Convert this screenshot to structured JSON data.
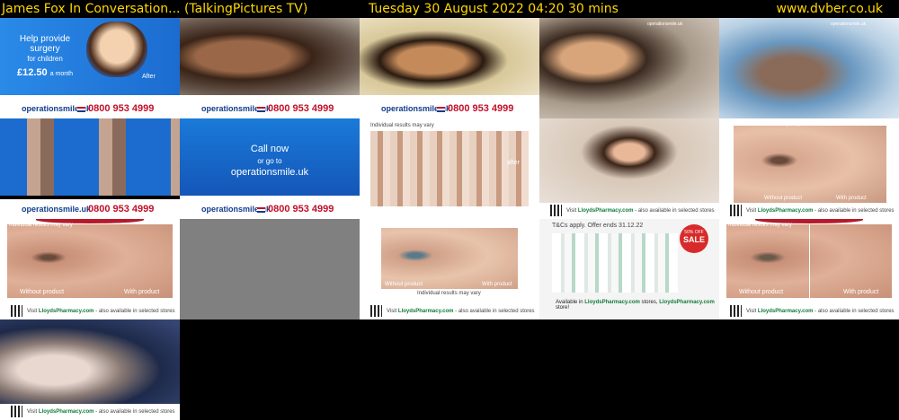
{
  "header": {
    "title": "James Fox In Conversation... (TalkingPictures TV)",
    "datetime": "Tuesday 30 August 2022  04:20  30 mins",
    "site": "www.dvber.co.uk"
  },
  "operation_smile": {
    "logo": "operationsmile.uk",
    "phone": "0800 953 4999",
    "help_line1": "Help provide",
    "help_line2": "surgery",
    "help_line3": "for children",
    "price": "£12.50",
    "price_suffix": "a month",
    "after": "After",
    "call_line1": "Call now",
    "call_line2": "or go to",
    "call_line3": "operationsmile.uk"
  },
  "lloyds": {
    "visit": "Visit",
    "brand": "LloydsPharmacy.com",
    "rest": "- also available in selected stores",
    "individual": "Individual results may vary",
    "without": "Without product",
    "with": "With product",
    "after": "after",
    "tc": "T&Cs apply. Offer ends 31.12.22",
    "sale_top": "50% OFF",
    "sale": "SALE",
    "available": "Available in",
    "stores": "stores,",
    "store": "store!"
  },
  "colors": {
    "header_text": "#ffd700",
    "os_blue": "#1a6fd0",
    "os_red": "#c0102a",
    "lloyds_green": "#117a3a"
  }
}
